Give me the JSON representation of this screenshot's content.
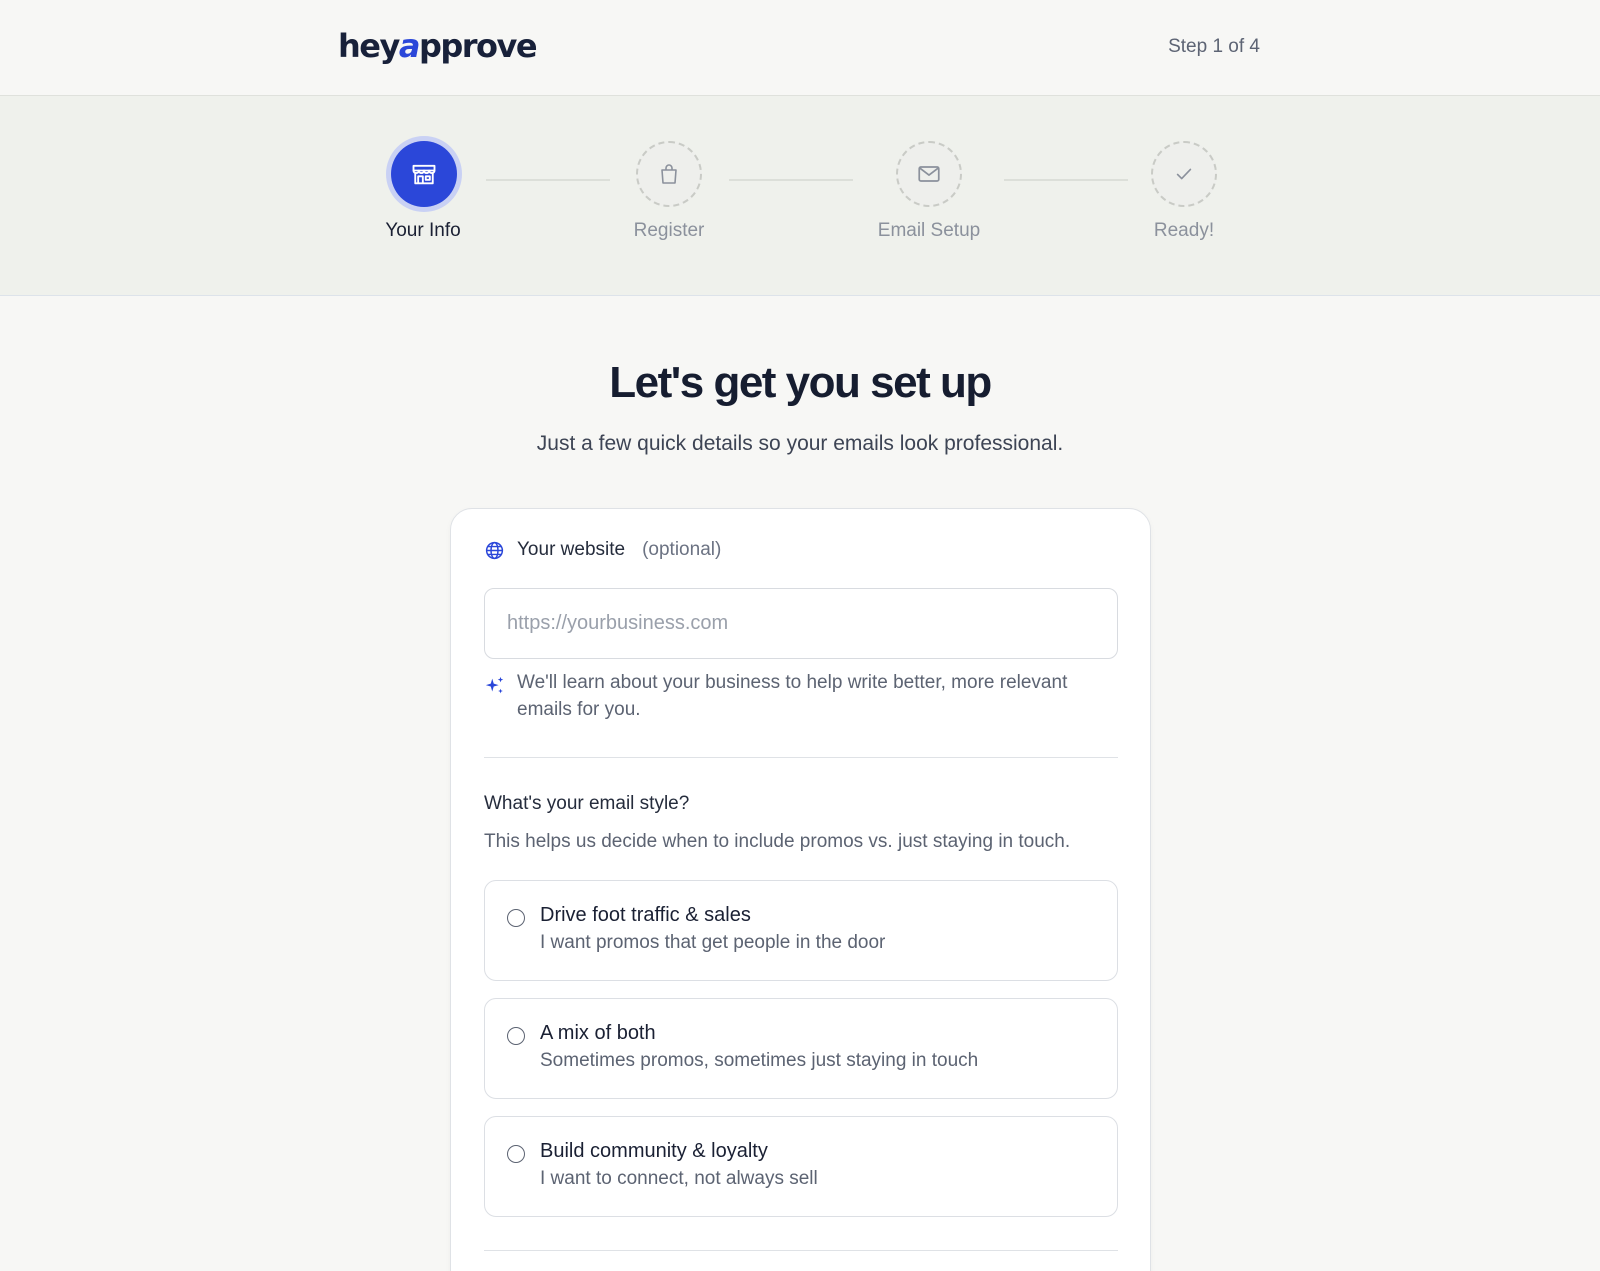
{
  "header": {
    "logo_text": [
      "hey",
      "a",
      "pprove"
    ],
    "step_count": "Step 1 of 4"
  },
  "stepper": {
    "steps": [
      {
        "label": "Your Info",
        "icon": "storefront-icon",
        "state": "active"
      },
      {
        "label": "Register",
        "icon": "shopping-bag-icon",
        "state": "pending"
      },
      {
        "label": "Email Setup",
        "icon": "envelope-icon",
        "state": "pending"
      },
      {
        "label": "Ready!",
        "icon": "checkmark-icon",
        "state": "pending"
      }
    ]
  },
  "main": {
    "title": "Let's get you set up",
    "subtitle": "Just a few quick details so your emails look professional."
  },
  "form": {
    "website": {
      "label": "Your website",
      "optional": "(optional)",
      "placeholder": "https://yourbusiness.com",
      "value": "",
      "hint": "We'll learn about your business to help write better, more relevant emails for you."
    },
    "email_style": {
      "title": "What's your email style?",
      "description": "This helps us decide when to include promos vs. just staying in touch.",
      "options": [
        {
          "title": "Drive foot traffic & sales",
          "description": "I want promos that get people in the door",
          "selected": false
        },
        {
          "title": "A mix of both",
          "description": "Sometimes promos, sometimes just staying in touch",
          "selected": false
        },
        {
          "title": "Build community & loyalty",
          "description": "I want to connect, not always sell",
          "selected": false
        }
      ]
    }
  },
  "colors": {
    "accent": "#2b47d9",
    "page_background": "#f7f7f5",
    "stepper_background": "#eff1ec",
    "text_primary": "#1a2033",
    "text_muted": "#5c6372"
  }
}
